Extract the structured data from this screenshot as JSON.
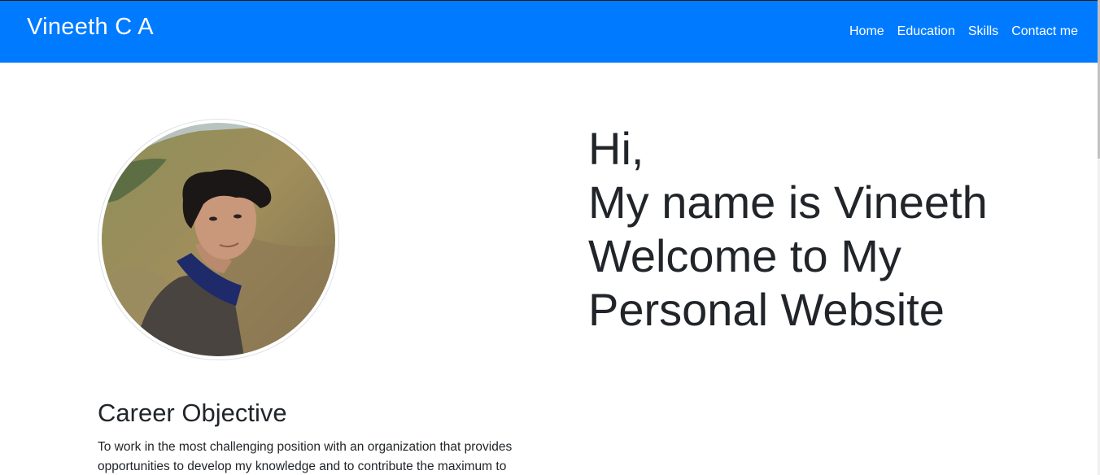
{
  "navbar": {
    "brand": "Vineeth C A",
    "links": [
      "Home",
      "Education",
      "Skills",
      "Contact me"
    ],
    "background_color": "#007bff"
  },
  "profile": {
    "photo": "profile-photo"
  },
  "hero": {
    "line1": "Hi,",
    "line2": "My name is Vineeth",
    "line3": "Welcome to My",
    "line4": "Personal Website"
  },
  "career": {
    "title": "Career Objective",
    "text": "To work in the most challenging position with an organization that provides opportunities to develop my knowledge and to contribute the maximum to"
  }
}
